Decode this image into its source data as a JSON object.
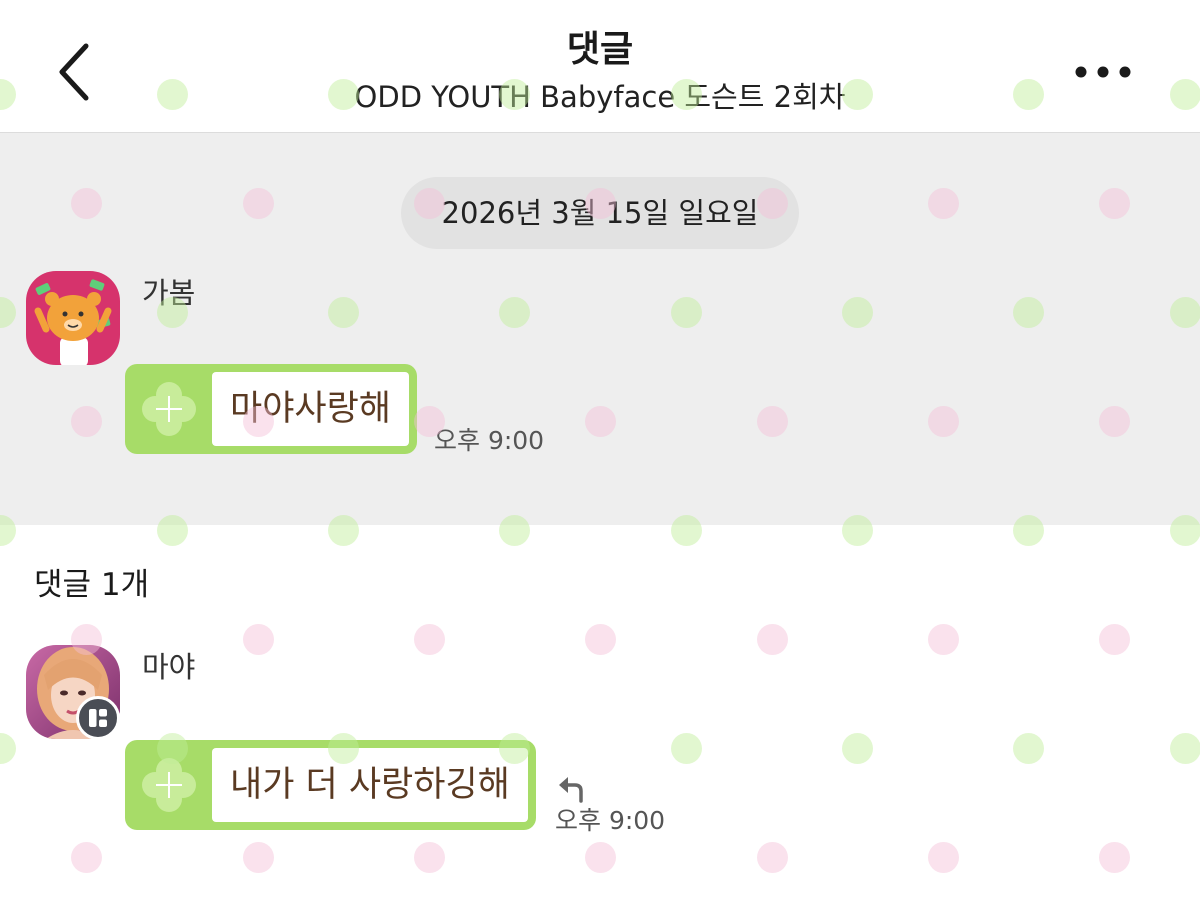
{
  "header": {
    "title": "댓글",
    "subtitle": "ODD YOUTH Babyface 도슨트 2회차",
    "back_icon": "chevron-left-icon",
    "more_icon": "more-horizontal-icon"
  },
  "post": {
    "date": "2026년 3월 15일 일요일",
    "author": "가봄",
    "message": "마야사랑해",
    "time": "오후 9:00"
  },
  "comments": {
    "label": "댓글 1개",
    "items": [
      {
        "author": "마야",
        "message": "내가 더 사랑하깅해",
        "time": "오후 9:00",
        "reply_icon": "reply-icon"
      }
    ]
  },
  "colors": {
    "bubble_green": "#a7dc68",
    "post_background": "#eeeeee",
    "message_text": "#5a3a22",
    "avatar_pink": "#d6336c",
    "dot_green": "#beee96",
    "dot_pink": "#f5bed7"
  }
}
